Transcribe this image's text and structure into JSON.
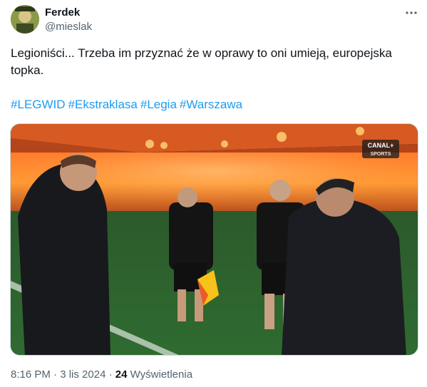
{
  "author": {
    "name": "Ferdek",
    "handle": "@mieslak",
    "avatar_icon": "avatar-icon"
  },
  "tweet": {
    "text": "Legioniści... Trzeba im przyznać że w oprawy to oni umieją, europejska topka.",
    "hashtags": [
      "#LEGWID",
      "#Ekstraklasa",
      "#Legia",
      "#Warszawa"
    ]
  },
  "media": {
    "broadcaster_logo_top": "CANAL+",
    "broadcaster_logo_bottom": "SPORTS"
  },
  "meta": {
    "time": "8:16 PM",
    "separator": "·",
    "date": "3 lis 2024",
    "separator2": "·",
    "views_count": "24",
    "views_label": "Wyświetlenia"
  },
  "colors": {
    "link": "#1d9bf0",
    "secondary_text": "#536471"
  }
}
